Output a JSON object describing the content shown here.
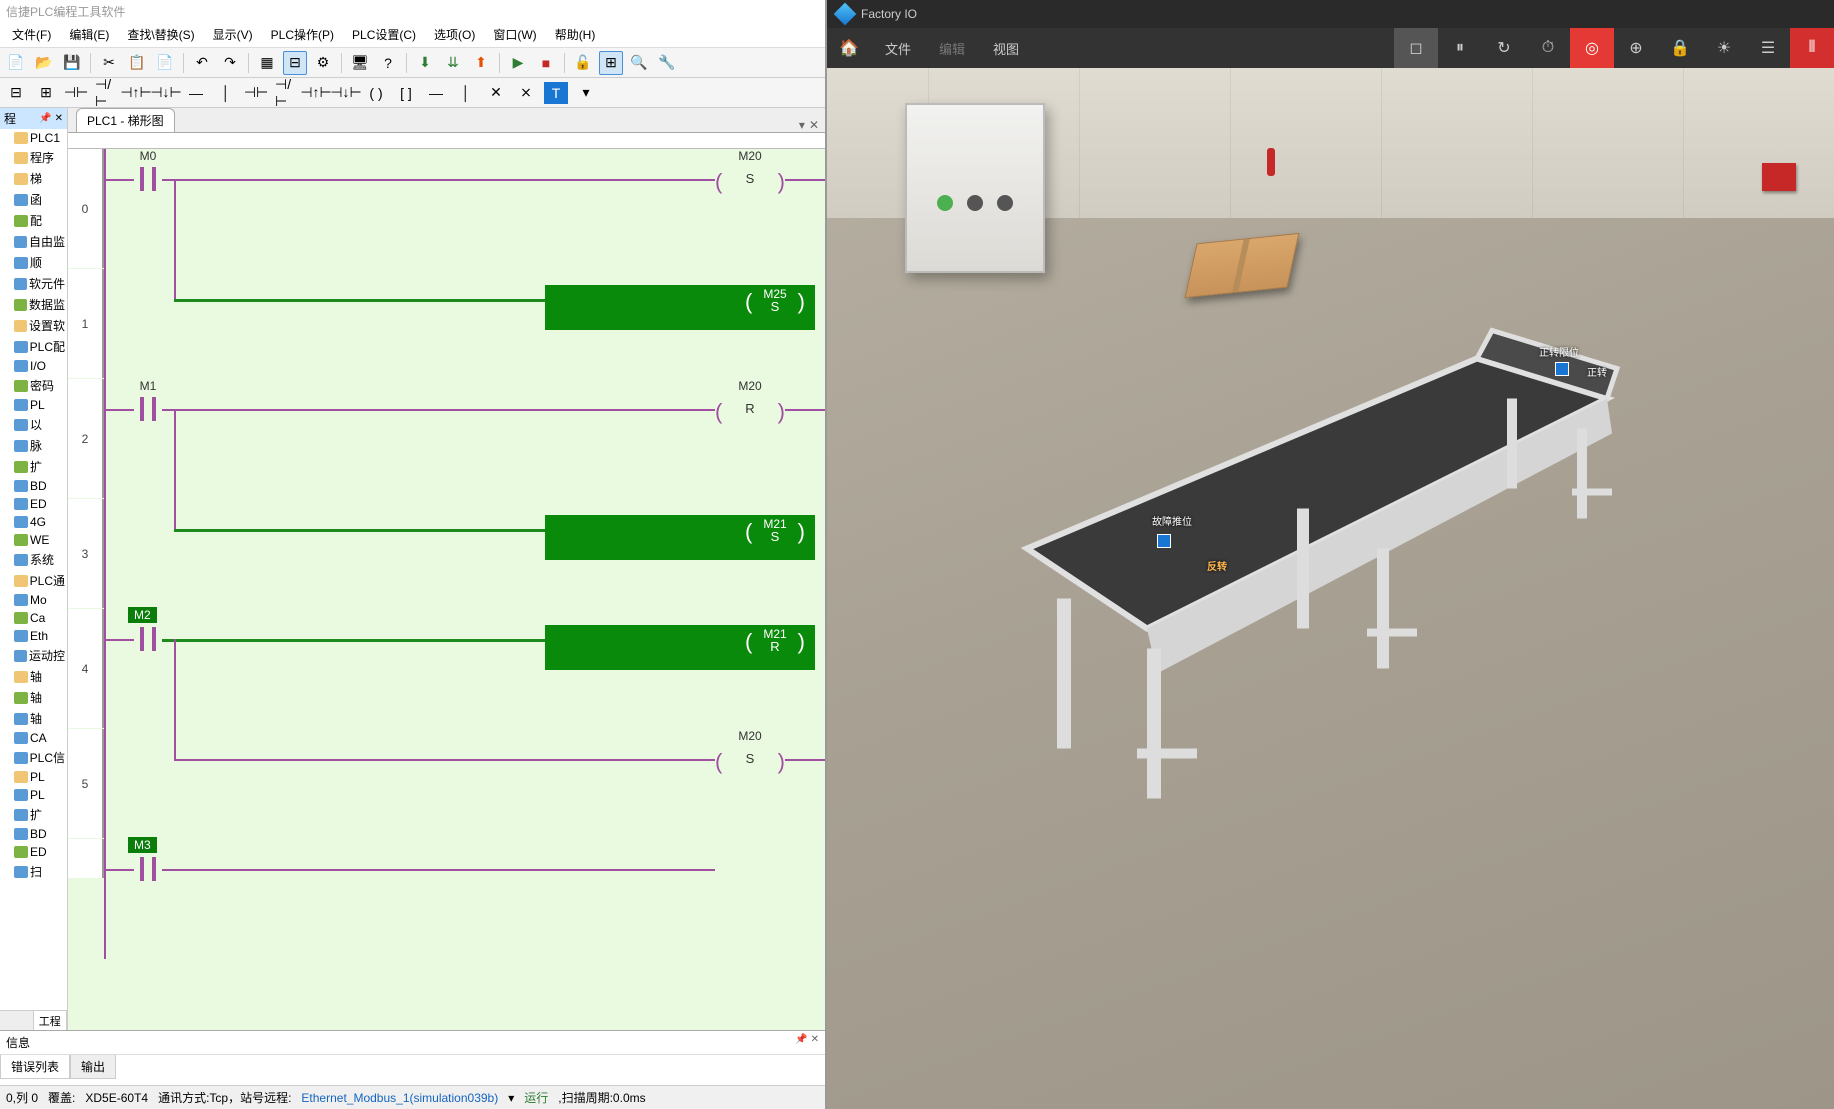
{
  "plc": {
    "title": "信捷PLC编程工具软件",
    "menu": [
      "文件(F)",
      "编辑(E)",
      "查找\\替换(S)",
      "显示(V)",
      "PLC操作(P)",
      "PLC设置(C)",
      "选项(O)",
      "窗口(W)",
      "帮助(H)"
    ],
    "tab": "PLC1 - 梯形图",
    "tree_head": "程",
    "tree": [
      "PLC1",
      "程序",
      "梯",
      "函",
      "配",
      "自由监",
      "顺",
      "软元件",
      "数据监",
      "设置软",
      "PLC配",
      "I/O",
      "密码",
      "PL",
      "以",
      "脉",
      "扩",
      "BD",
      "ED",
      "4G",
      "WE",
      "系统",
      "PLC通",
      "Mo",
      "Ca",
      "Eth",
      "运动控",
      "轴",
      "轴",
      "轴",
      "CA",
      "PLC信",
      "PL",
      "PL",
      "扩",
      "BD",
      "ED",
      "扫"
    ],
    "tree_tabs": [
      "",
      "工程"
    ],
    "rungs": [
      {
        "n": "0",
        "contact": "M0",
        "coil": "M20",
        "ctxt": "S",
        "green": false,
        "active": false
      },
      {
        "n": "1",
        "contact": "",
        "coil": "M25",
        "ctxt": "S",
        "green": true,
        "active": false,
        "branch": true
      },
      {
        "n": "2",
        "contact": "M1",
        "coil": "M20",
        "ctxt": "R",
        "green": false,
        "active": false
      },
      {
        "n": "3",
        "contact": "",
        "coil": "M21",
        "ctxt": "S",
        "green": true,
        "active": false,
        "branch": true
      },
      {
        "n": "4",
        "contact": "M2",
        "coil": "M21",
        "ctxt": "R",
        "green": true,
        "active": true
      },
      {
        "n": "5",
        "contact": "",
        "coil": "M20",
        "ctxt": "S",
        "green": false,
        "active": false,
        "branch": true
      },
      {
        "n": "",
        "contact": "M3",
        "coil": "",
        "ctxt": "",
        "green": false,
        "active": true,
        "short": true
      }
    ],
    "bottom_head": "信息",
    "bottom_tabs": [
      "错误列表",
      "输出"
    ],
    "status": {
      "pos": "0,列 0",
      "model_lbl": "覆盖:",
      "model": "XD5E-60T4",
      "comm_lbl": "通讯方式:Tcp，站号远程:",
      "comm": "Ethernet_Modbus_1(simulation039b)",
      "run": "运行",
      "scan": ",扫描周期:0.0ms"
    }
  },
  "fio": {
    "title": "Factory IO",
    "menu_text": [
      "文件",
      "编辑",
      "视图"
    ],
    "labels": {
      "reverse": "反转",
      "reset": "故障推位",
      "pos": "正转限位",
      "fwd": "正转"
    }
  }
}
